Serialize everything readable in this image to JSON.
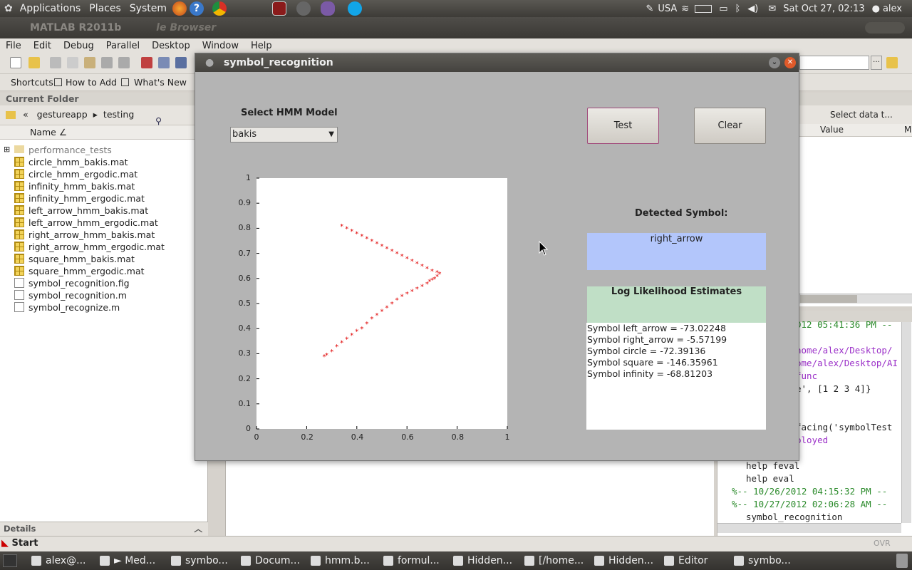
{
  "top_panel": {
    "menus": [
      "Applications",
      "Places",
      "System"
    ],
    "tray": {
      "keyboard": "USA",
      "datetime": "Sat Oct 27, 02:13",
      "user": "alex"
    }
  },
  "matlab": {
    "title": "MATLAB  R2011b",
    "title_suffix": "le Browser",
    "menu": [
      "File",
      "Edit",
      "Debug",
      "Parallel",
      "Desktop",
      "Window",
      "Help"
    ],
    "shortcuts": [
      "Shortcuts",
      "How to Add",
      "What's New"
    ],
    "current_folder": {
      "header": "Current Folder",
      "path": [
        "«",
        "gestureapp",
        "testing"
      ],
      "column_name": "Name ∠",
      "folder": "performance_tests",
      "files": [
        {
          "name": "circle_hmm_bakis.mat",
          "type": "mat"
        },
        {
          "name": "circle_hmm_ergodic.mat",
          "type": "mat"
        },
        {
          "name": "infinity_hmm_bakis.mat",
          "type": "mat"
        },
        {
          "name": "infinity_hmm_ergodic.mat",
          "type": "mat"
        },
        {
          "name": "left_arrow_hmm_bakis.mat",
          "type": "mat"
        },
        {
          "name": "left_arrow_hmm_ergodic.mat",
          "type": "mat"
        },
        {
          "name": "right_arrow_hmm_bakis.mat",
          "type": "mat"
        },
        {
          "name": "right_arrow_hmm_ergodic.mat",
          "type": "mat"
        },
        {
          "name": "square_hmm_bakis.mat",
          "type": "mat"
        },
        {
          "name": "square_hmm_ergodic.mat",
          "type": "mat"
        },
        {
          "name": "symbol_recognition.fig",
          "type": "fig"
        },
        {
          "name": "symbol_recognition.m",
          "type": "m"
        },
        {
          "name": "symbol_recognize.m",
          "type": "m"
        }
      ],
      "details": "Details"
    },
    "workspace": {
      "select_data": "Select data t...",
      "value_col": "Value",
      "m_col": "M"
    },
    "history": [
      {
        "text": "012 05:41:36 PM --",
        "color": "#2a8a2a"
      },
      {
        "text": "home/alex/Desktop/",
        "color": "#9b30c8"
      },
      {
        "text": "ome/alex/Desktop/AI",
        "color": "#9b30c8"
      },
      {
        "text": "func",
        "color": "#9b30c8"
      },
      {
        "text": "e', [1 2 3 4]}",
        "color": "#222",
        "prefix": "e'",
        "prefix_color": "#9b30c8"
      },
      {
        "text": "facing('symbolTest",
        "color": "#222"
      },
      {
        "text": "ployed",
        "color": "#9b30c8"
      },
      {
        "text": "help feval",
        "color": "#222"
      },
      {
        "text": "help eval",
        "color": "#222"
      },
      {
        "text": "%-- 10/26/2012 04:15:32 PM --",
        "color": "#2a8a2a"
      },
      {
        "text": "%-- 10/27/2012 02:06:28 AM --",
        "color": "#2a8a2a"
      },
      {
        "text": "symbol_recognition",
        "color": "#222"
      }
    ],
    "status": "OVR"
  },
  "figure": {
    "title": "symbol_recognition",
    "select_label": "Select HMM Model",
    "model_value": "bakis",
    "test_label": "Test",
    "clear_label": "Clear",
    "detected_label": "Detected Symbol:",
    "detected_value": "right_arrow",
    "loglik_label": "Log Likelihood Estimates",
    "estimates": [
      "Symbol left_arrow = -73.02248",
      "Symbol right_arrow = -5.57199",
      "Symbol circle = -72.39136",
      "Symbol square = -146.35961",
      "Symbol infinity = -68.81203"
    ],
    "colors": {
      "detected_bg": "#b3c6fb",
      "loglik_bg": "#c0dfc6",
      "points": "#e00000"
    }
  },
  "chart_data": {
    "type": "scatter",
    "xlim": [
      0,
      1
    ],
    "ylim": [
      0,
      1
    ],
    "xticks": [
      "0",
      "0.2",
      "0.4",
      "0.6",
      "0.8",
      "1"
    ],
    "yticks": [
      "0",
      "0.1",
      "0.2",
      "0.3",
      "0.4",
      "0.5",
      "0.6",
      "0.7",
      "0.8",
      "0.9",
      "1"
    ],
    "series": [
      {
        "points": [
          [
            0.34,
            0.81
          ],
          [
            0.36,
            0.8
          ],
          [
            0.38,
            0.79
          ],
          [
            0.4,
            0.78
          ],
          [
            0.42,
            0.77
          ],
          [
            0.44,
            0.76
          ],
          [
            0.46,
            0.75
          ],
          [
            0.48,
            0.74
          ],
          [
            0.5,
            0.73
          ],
          [
            0.52,
            0.72
          ],
          [
            0.54,
            0.71
          ],
          [
            0.56,
            0.7
          ],
          [
            0.58,
            0.69
          ],
          [
            0.6,
            0.68
          ],
          [
            0.62,
            0.67
          ],
          [
            0.64,
            0.66
          ],
          [
            0.66,
            0.65
          ],
          [
            0.68,
            0.64
          ],
          [
            0.7,
            0.63
          ],
          [
            0.72,
            0.625
          ],
          [
            0.73,
            0.62
          ],
          [
            0.72,
            0.61
          ],
          [
            0.71,
            0.6
          ],
          [
            0.7,
            0.595
          ],
          [
            0.69,
            0.59
          ],
          [
            0.68,
            0.58
          ],
          [
            0.66,
            0.57
          ],
          [
            0.64,
            0.56
          ],
          [
            0.62,
            0.55
          ],
          [
            0.6,
            0.54
          ],
          [
            0.58,
            0.53
          ],
          [
            0.56,
            0.515
          ],
          [
            0.54,
            0.5
          ],
          [
            0.52,
            0.485
          ],
          [
            0.5,
            0.47
          ],
          [
            0.48,
            0.455
          ],
          [
            0.46,
            0.44
          ],
          [
            0.44,
            0.42
          ],
          [
            0.42,
            0.4
          ],
          [
            0.4,
            0.39
          ],
          [
            0.38,
            0.375
          ],
          [
            0.36,
            0.36
          ],
          [
            0.34,
            0.345
          ],
          [
            0.32,
            0.33
          ],
          [
            0.3,
            0.31
          ],
          [
            0.28,
            0.295
          ],
          [
            0.27,
            0.29
          ]
        ]
      }
    ]
  },
  "taskbar": {
    "start": "Start",
    "tasks": [
      "alex@...",
      "► Med...",
      "symbo...",
      "Docum...",
      "hmm.b...",
      "formul...",
      "Hidden...",
      "[/home...",
      "Hidden...",
      "Editor",
      "symbo..."
    ]
  }
}
